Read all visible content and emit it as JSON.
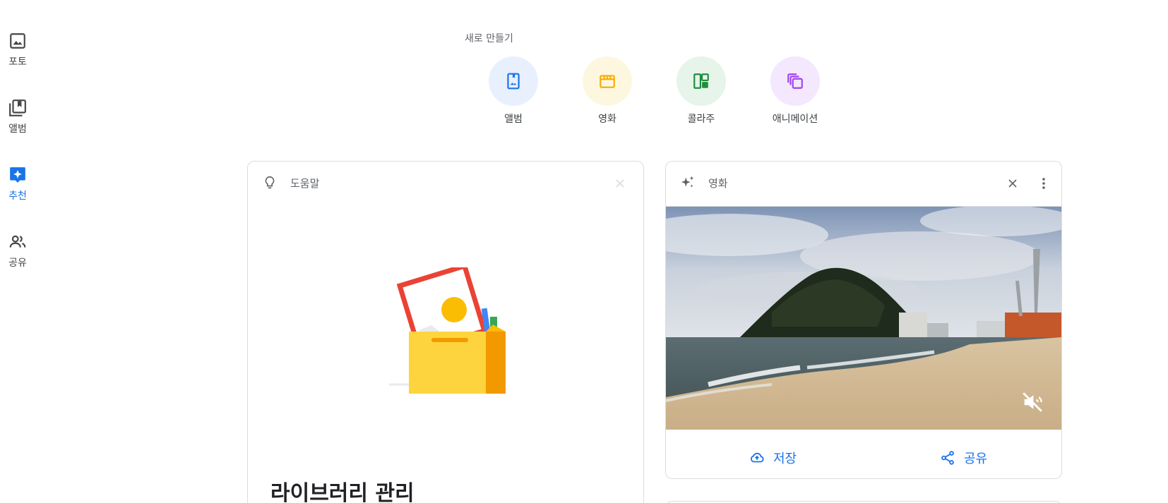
{
  "nav": {
    "items": [
      {
        "label": "포토",
        "icon": "photo-icon"
      },
      {
        "label": "앨범",
        "icon": "album-icon"
      },
      {
        "label": "추천",
        "icon": "sparkle-badge-icon",
        "active": true
      },
      {
        "label": "공유",
        "icon": "people-icon"
      }
    ]
  },
  "create": {
    "title": "새로 만들기",
    "items": [
      {
        "label": "앨범",
        "icon": "album-add-icon",
        "bg": "#e8f0fe",
        "color": "#1a73e8"
      },
      {
        "label": "영화",
        "icon": "movie-clapper-icon",
        "bg": "#fef7e0",
        "color": "#f9ab00"
      },
      {
        "label": "콜라주",
        "icon": "collage-icon",
        "bg": "#e6f4ea",
        "color": "#1e8e3e"
      },
      {
        "label": "애니메이션",
        "icon": "animation-icon",
        "bg": "#f3e8fd",
        "color": "#a142f4"
      }
    ]
  },
  "help_card": {
    "header": "도움말",
    "title": "라이브러리 관리"
  },
  "movie_card": {
    "header": "영화",
    "save_label": "저장",
    "share_label": "공유"
  },
  "colors": {
    "accent": "#1a73e8"
  }
}
